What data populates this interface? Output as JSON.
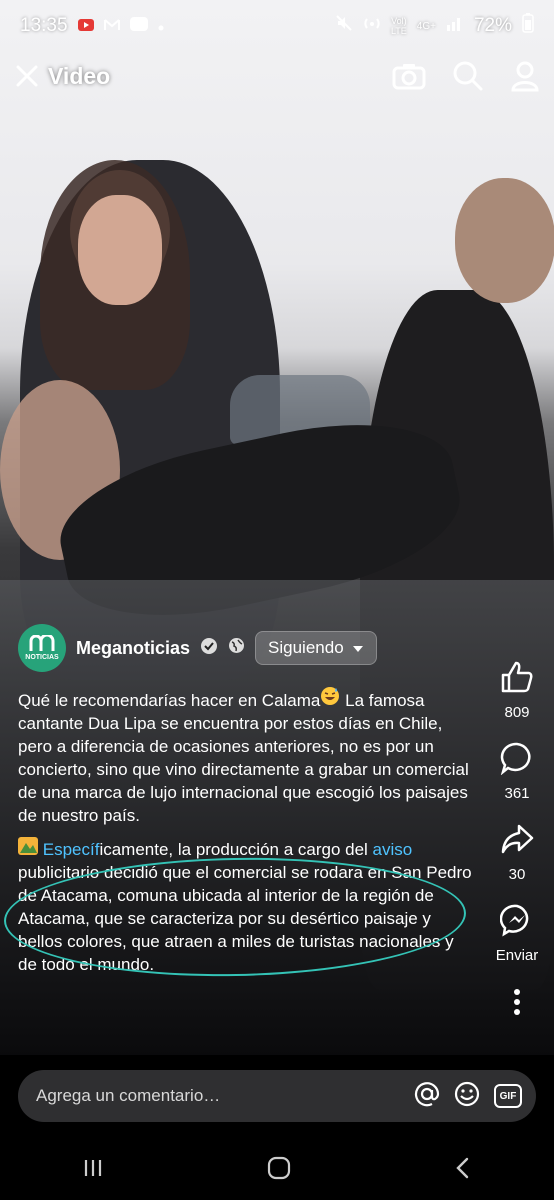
{
  "status_bar": {
    "time": "13:35",
    "battery": "72%",
    "signal_label_top": "Vol)",
    "signal_label_bottom": "LTE",
    "network": "4G+"
  },
  "header": {
    "title": "Video"
  },
  "post": {
    "page_name": "Meganoticias",
    "avatar_text": "NOTICIAS",
    "follow_label": "Siguiendo",
    "caption_p1": "Qué le recomendarías hacer en Calama",
    "caption_p1_rest": " La famosa cantante Dua Lipa se encuentra por estos días en Chile, pero a diferencia de ocasiones anteriores, no es por un concierto, sino que vino directamente a grabar un comercial de una marca de lujo internacional que escogió los paisajes de nuestro país.",
    "caption_p2_link1": "Específ",
    "caption_p2_a": "icamente, la producción a cargo del ",
    "caption_p2_link2": "aviso",
    "caption_p2_b": " publicitario decidió que el comercial se rodara en San Pedro de Atacama, comuna ubicada al interior de la región de Atacama, que se caracteriza por su desértico paisaje y bellos colores, que atraen a miles de turistas nacionales y de todo el mundo."
  },
  "actions": {
    "likes": "809",
    "comments": "361",
    "shares": "30",
    "send_label": "Enviar"
  },
  "comment": {
    "placeholder": "Agrega un comentario…",
    "gif_label": "GIF"
  },
  "colors": {
    "accent": "#34c3b6",
    "avatar": "#27a37a",
    "link": "#4fc3ff"
  },
  "icons": [
    "close-icon",
    "camera-icon",
    "search-icon",
    "profile-icon",
    "like-icon",
    "comment-icon",
    "share-icon",
    "messenger-icon",
    "more-icon",
    "verified-icon",
    "globe-icon",
    "chevron-down-icon",
    "at-icon",
    "emoji-icon",
    "gif-icon",
    "recents-icon",
    "home-icon",
    "back-icon"
  ]
}
